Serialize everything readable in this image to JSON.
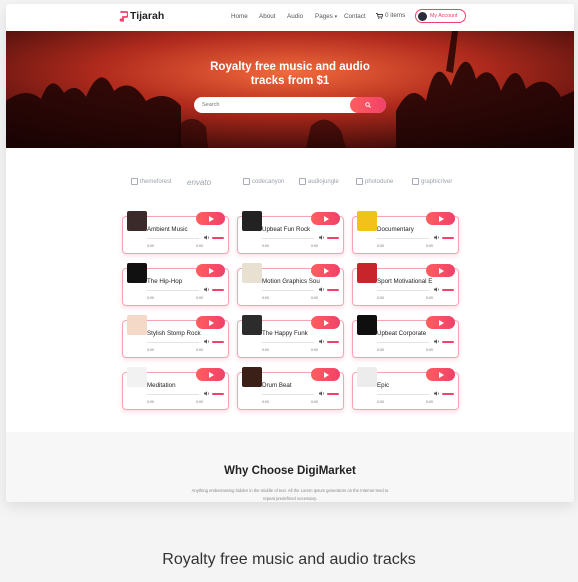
{
  "nav": {
    "logo": "Tijarah",
    "links": [
      "Home",
      "About",
      "Audio",
      "Pages",
      "Contact"
    ],
    "cart": "0 items",
    "account": "My Account"
  },
  "hero": {
    "title_line1": "Royalty free music and audio",
    "title_line2": "tracks from $1",
    "search_placeholder": "Search"
  },
  "brands": [
    "themeforest",
    "envato",
    "codecanyon",
    "audiojungle",
    "photodune",
    "graphicriver"
  ],
  "tracks": [
    {
      "name": "Ambient Music",
      "current": "0:00",
      "duration": "0:00"
    },
    {
      "name": "Upbeat Fun Rock",
      "current": "0:00",
      "duration": "0:00"
    },
    {
      "name": "Documentary",
      "current": "0:00",
      "duration": "0:00"
    },
    {
      "name": "The Hip-Hop",
      "current": "0:00",
      "duration": "0:00"
    },
    {
      "name": "Motion Graphics Sou",
      "current": "0:00",
      "duration": "0:00"
    },
    {
      "name": "Sport Motivational E",
      "current": "0:00",
      "duration": "0:00"
    },
    {
      "name": "Stylish Stomp Rock",
      "current": "0:00",
      "duration": "0:00"
    },
    {
      "name": "The Happy Funk",
      "current": "0:00",
      "duration": "0:00"
    },
    {
      "name": "Upbeat Corporate",
      "current": "0:00",
      "duration": "0:00"
    },
    {
      "name": "Meditation",
      "current": "0:00",
      "duration": "0:00"
    },
    {
      "name": "Drum Beat",
      "current": "0:00",
      "duration": "0:00"
    },
    {
      "name": "Epic",
      "current": "0:00",
      "duration": "0:00"
    }
  ],
  "why": {
    "title": "Why Choose DigiMarket",
    "text": "Anything embarrassing hidden in the middle of text. All the Lorem Ipsum generators on the Internet tend to repeat predefined necessary."
  },
  "bottom_title": "Royalty free music and audio tracks",
  "colors": {
    "accent": "#f0416a",
    "accent_light": "#ff5e5e"
  }
}
